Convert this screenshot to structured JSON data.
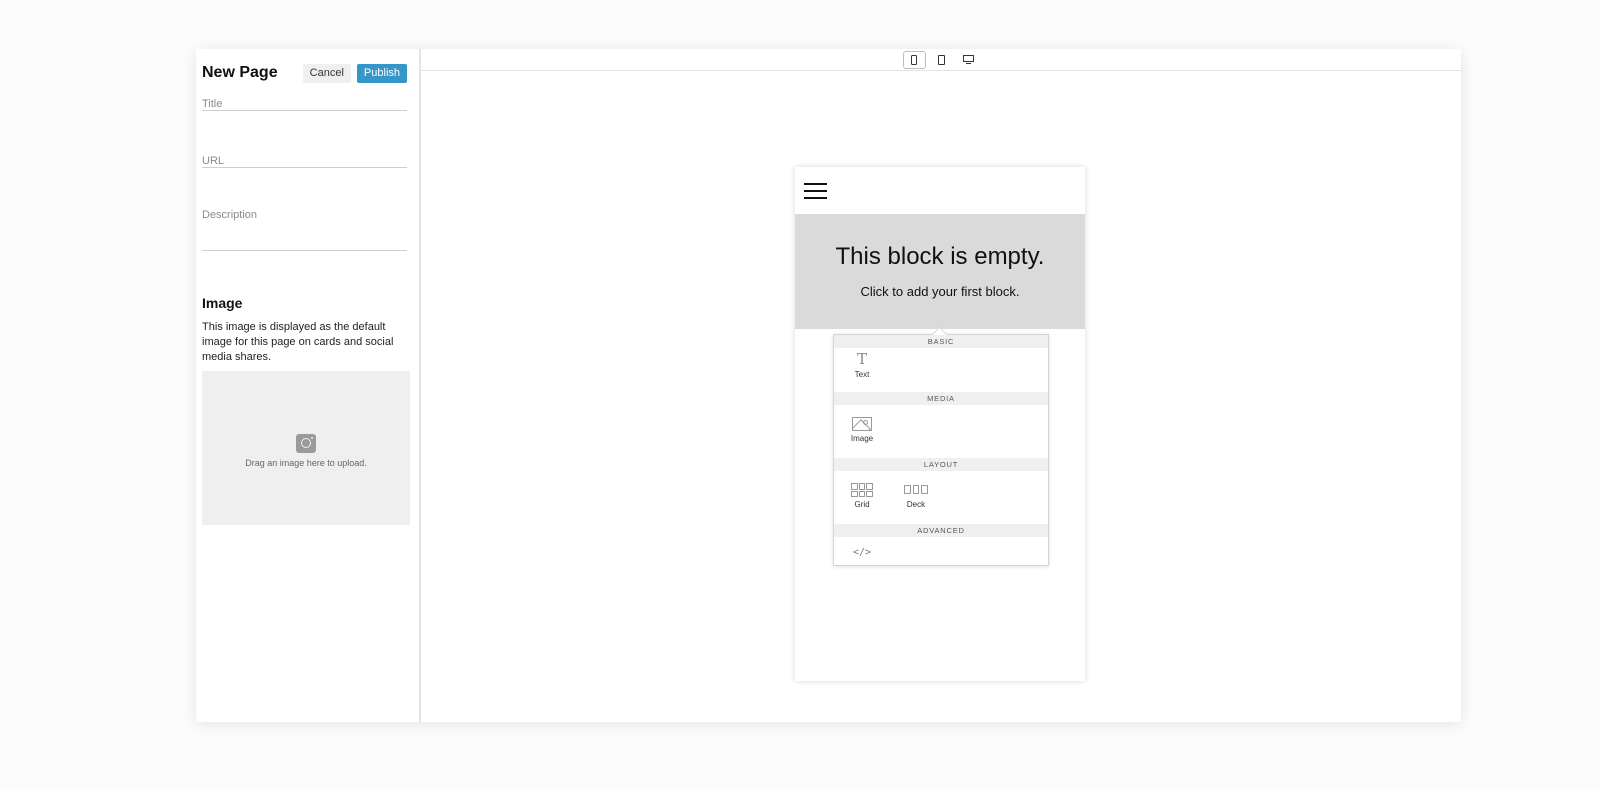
{
  "sidebar": {
    "title": "New Page",
    "cancel_label": "Cancel",
    "publish_label": "Publish",
    "fields": {
      "title_placeholder": "Title",
      "url_placeholder": "URL",
      "description_placeholder": "Description"
    },
    "image": {
      "heading": "Image",
      "description": "This image is displayed as the default image for this page on cards and social media shares.",
      "dropzone_text": "Drag an image here to upload."
    }
  },
  "toolbar": {
    "devices": [
      "phone",
      "tablet",
      "desktop"
    ],
    "active_device": "phone"
  },
  "preview": {
    "empty_title": "This block is empty.",
    "empty_subtitle": "Click to add your first block."
  },
  "block_menu": {
    "sections": {
      "basic": "BASIC",
      "media": "MEDIA",
      "layout": "LAYOUT",
      "advanced": "ADVANCED"
    },
    "items": {
      "text": "Text",
      "image": "Image",
      "grid": "Grid",
      "deck": "Deck"
    }
  },
  "colors": {
    "accent": "#3596c9",
    "empty_block_bg": "#dadada",
    "dropzone_bg": "#efefef"
  }
}
